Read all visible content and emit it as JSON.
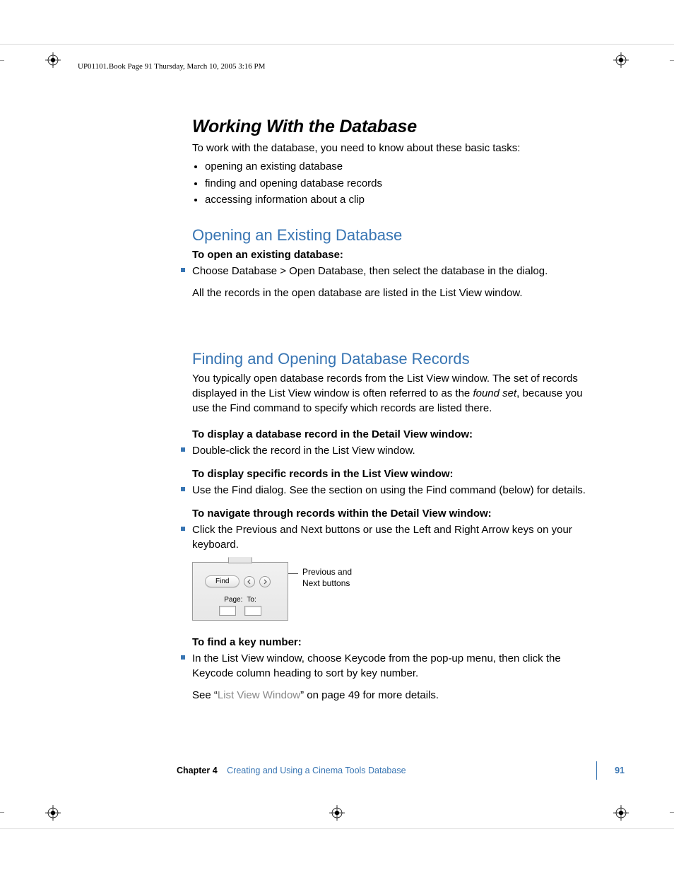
{
  "header": "UP01101.Book  Page 91  Thursday, March 10, 2005  3:16 PM",
  "h1": "Working With the Database",
  "intro": "To work with the database, you need to know about these basic tasks:",
  "introBullets": [
    "opening an existing database",
    "finding and opening database records",
    "accessing information about a clip"
  ],
  "sec1": {
    "title": "Opening an Existing Database",
    "lead": "To open an existing database:",
    "step": "Choose Database > Open Database, then select the database in the dialog.",
    "follow": "All the records in the open database are listed in the List View window."
  },
  "sec2": {
    "title": "Finding and Opening Database Records",
    "para_a": "You typically open database records from the List View window. The set of records displayed in the List View window is often referred to as the ",
    "para_em": "found set",
    "para_b": ", because you use the Find command to specify which records are listed there.",
    "lead1": "To display a database record in the Detail View window:",
    "step1": "Double-click the record in the List View window.",
    "lead2": "To display specific records in the List View window:",
    "step2": "Use the Find dialog. See the section on using the Find command (below) for details.",
    "lead3": "To navigate through records within the Detail View window:",
    "step3": "Click the Previous and Next buttons or use the Left and Right Arrow keys on your keyboard."
  },
  "figure": {
    "find": "Find",
    "page": "Page:",
    "to": "To:",
    "callout1": "Previous and",
    "callout2": "Next buttons"
  },
  "sec3": {
    "lead": "To find a key number:",
    "step": "In the List View window, choose Keycode from the pop-up menu, then click the Keycode column heading to sort by key number.",
    "see_a": "See “",
    "see_link": "List View Window",
    "see_b": "” on page 49 for more details."
  },
  "footer": {
    "chapter_bold": "Chapter 4",
    "chapter_title": "Creating and Using a Cinema Tools Database",
    "page": "91"
  }
}
